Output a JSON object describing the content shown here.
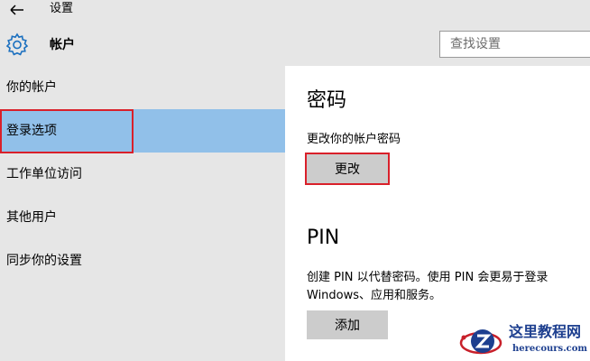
{
  "header": {
    "app_title": "设置",
    "section_title": "帐户",
    "back_icon": "back-arrow-icon",
    "section_icon": "gear-icon"
  },
  "search": {
    "placeholder": "查找设置",
    "value": ""
  },
  "sidebar": {
    "items": [
      {
        "label": "你的帐户",
        "selected": false
      },
      {
        "label": "登录选项",
        "selected": true
      },
      {
        "label": "工作单位访问",
        "selected": false
      },
      {
        "label": "其他用户",
        "selected": false
      },
      {
        "label": "同步你的设置",
        "selected": false
      }
    ]
  },
  "main": {
    "password": {
      "heading": "密码",
      "description": "更改你的帐户密码",
      "button_label": "更改"
    },
    "pin": {
      "heading": "PIN",
      "description": "创建 PIN 以代替密码。使用 PIN 会更易于登录Windows、应用和服务。",
      "button_label": "添加"
    }
  },
  "watermark": {
    "name": "这里教程网",
    "url": "herecours.com"
  },
  "colors": {
    "header_bg": "#e6e6e6",
    "sidebar_selected": "#91c0e9",
    "button_bg": "#cccccc",
    "highlight_border": "#d9202a",
    "watermark_text": "#1d3f8f"
  }
}
